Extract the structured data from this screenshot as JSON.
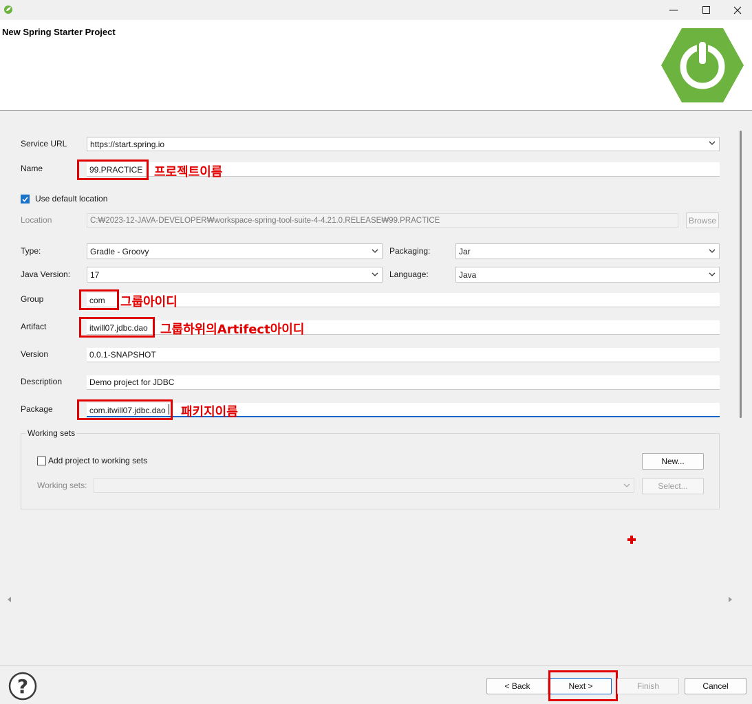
{
  "window": {
    "title": "",
    "controls": {
      "minimize_icon": "minimize-icon",
      "maximize_icon": "maximize-icon",
      "close_icon": "close-icon"
    }
  },
  "banner": {
    "title": "New Spring Starter Project",
    "logo_icon": "spring-power-logo"
  },
  "form": {
    "service_url": {
      "label": "Service URL",
      "value": "https://start.spring.io"
    },
    "name": {
      "label": "Name",
      "value": "99.PRACTICE",
      "annotation": "프로젝트이름"
    },
    "use_default_location": {
      "label": "Use default location",
      "checked": true
    },
    "location": {
      "label": "Location",
      "value": "C:₩2023-12-JAVA-DEVELOPER₩workspace-spring-tool-suite-4-4.21.0.RELEASE₩99.PRACTICE",
      "browse_label": "Browse"
    },
    "type": {
      "label": "Type:",
      "value": "Gradle - Groovy"
    },
    "packaging": {
      "label": "Packaging:",
      "value": "Jar"
    },
    "java_version": {
      "label": "Java Version:",
      "value": "17"
    },
    "language": {
      "label": "Language:",
      "value": "Java"
    },
    "group": {
      "label": "Group",
      "value": "com",
      "annotation": "그룹아이디"
    },
    "artifact": {
      "label": "Artifact",
      "value": "itwill07.jdbc.dao",
      "annotation": "그룹하위의Artifect아이디"
    },
    "version": {
      "label": "Version",
      "value": "0.0.1-SNAPSHOT"
    },
    "description": {
      "label": "Description",
      "value": "Demo project for JDBC"
    },
    "package": {
      "label": "Package",
      "value": "com.itwill07.jdbc.dao",
      "annotation": "패키지이름"
    }
  },
  "working_sets": {
    "title": "Working sets",
    "add_label": "Add project to working sets",
    "add_checked": false,
    "new_label": "New...",
    "sets_label": "Working sets:",
    "sets_value": "",
    "select_label": "Select..."
  },
  "footer": {
    "help_icon": "help-icon",
    "back_label": "< Back",
    "next_label": "Next >",
    "finish_label": "Finish",
    "cancel_label": "Cancel"
  },
  "colors": {
    "accent": "#1a73c8",
    "annotation": "#e00000",
    "spring_green": "#6db33f"
  }
}
